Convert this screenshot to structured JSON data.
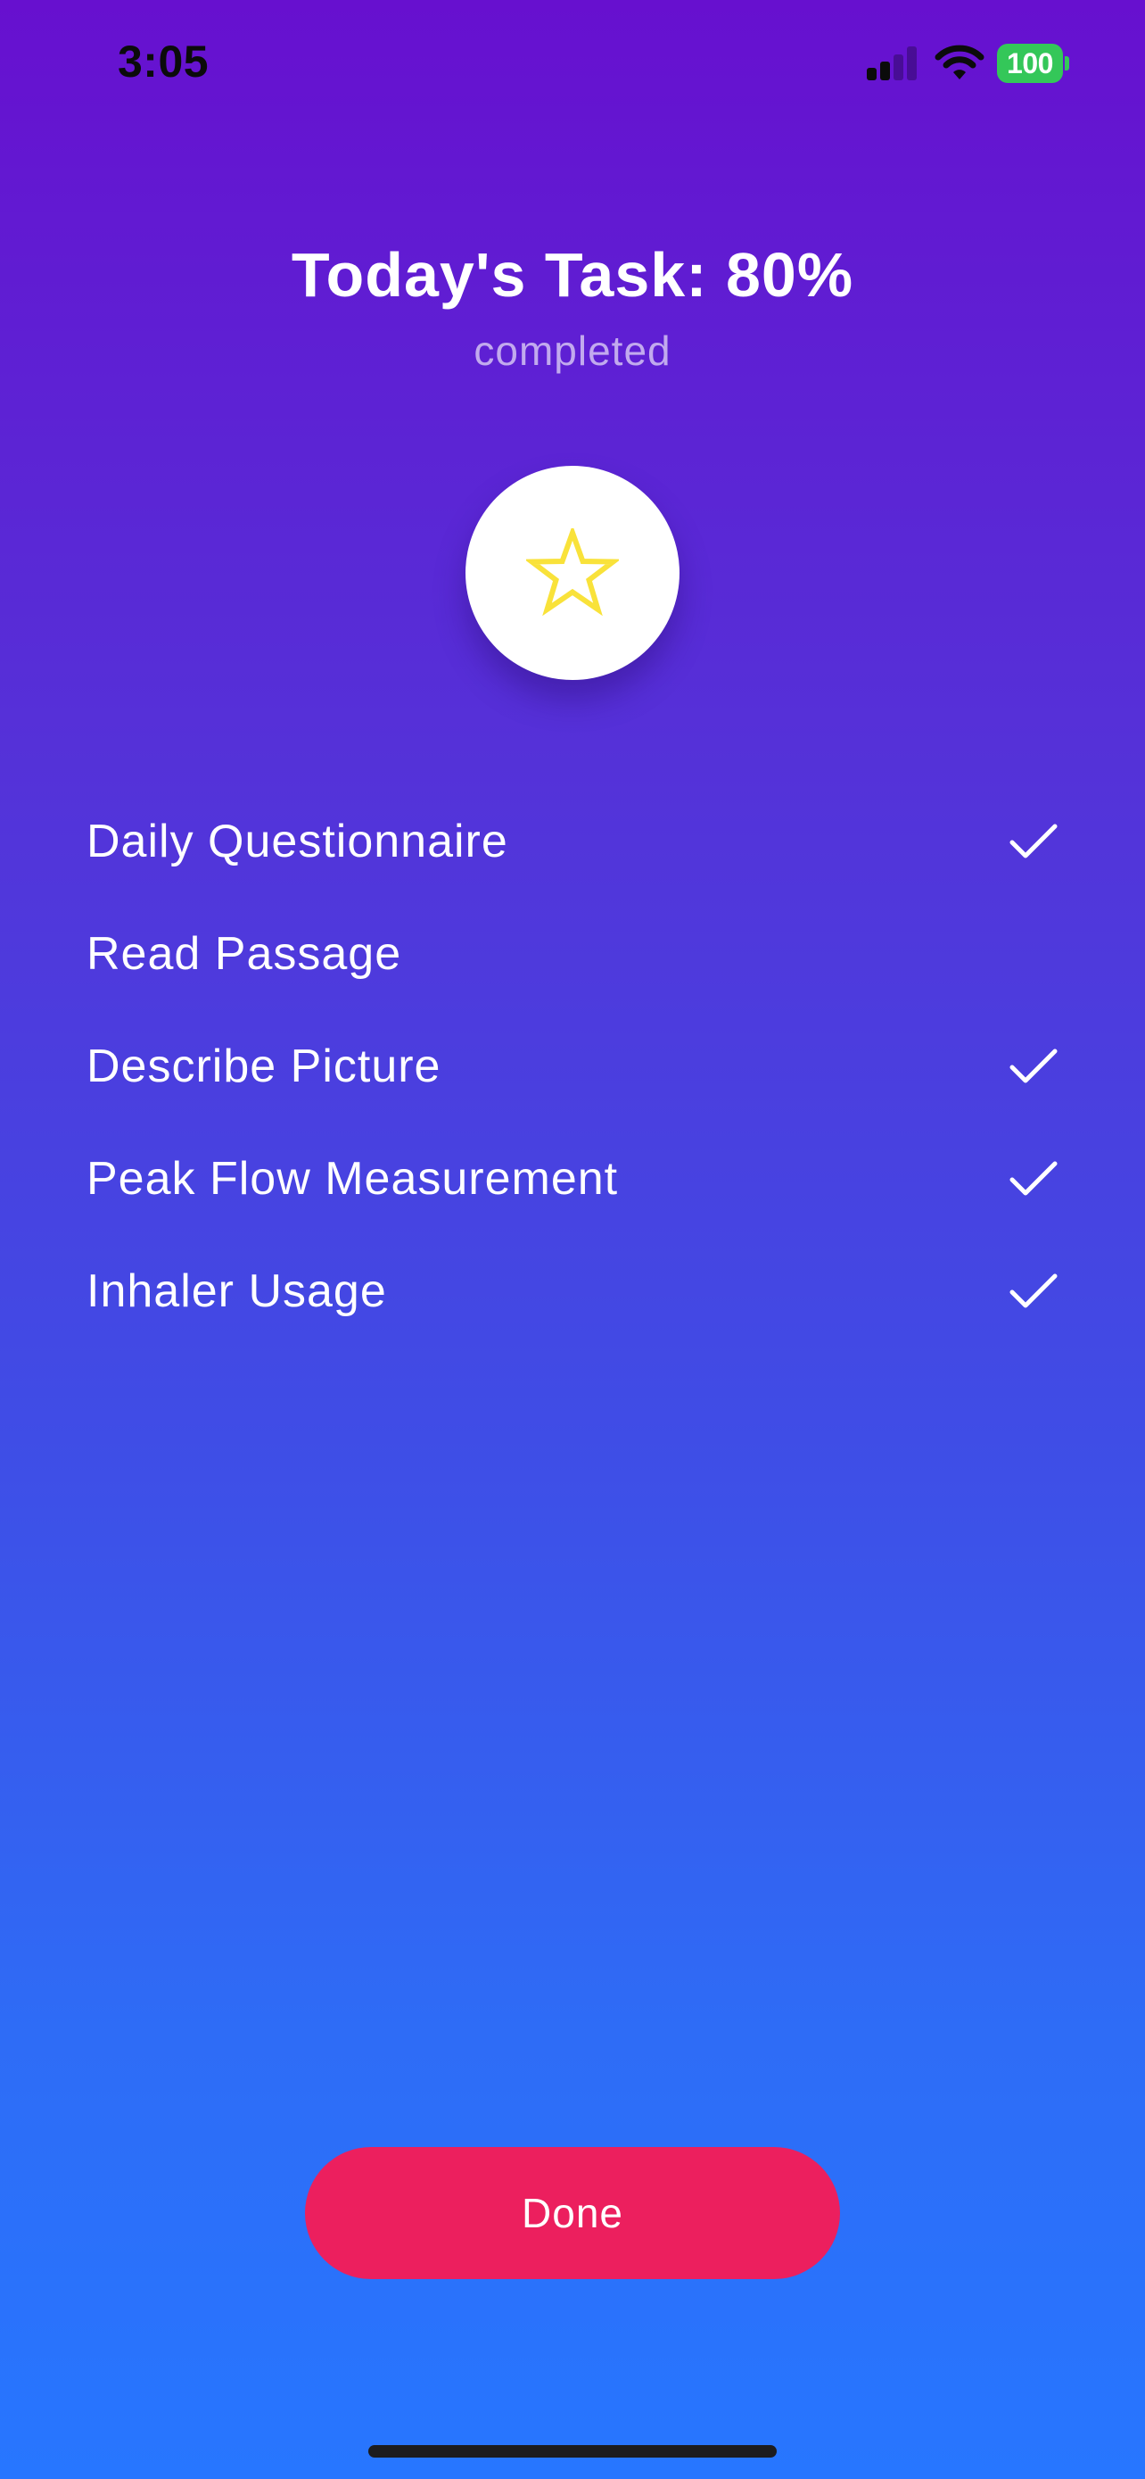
{
  "status_bar": {
    "time": "3:05",
    "battery": "100",
    "signal_bars_active": 2,
    "signal_bars_total": 4,
    "icons": [
      "signal-icon",
      "wifi-icon",
      "battery-icon"
    ]
  },
  "header": {
    "title": "Today's Task: 80%",
    "subtitle": "completed",
    "progress_percent": 80
  },
  "badge": {
    "icon": "star-icon",
    "star_color": "#F9E23A"
  },
  "tasks": [
    {
      "label": "Daily Questionnaire",
      "completed": true
    },
    {
      "label": "Read Passage",
      "completed": false
    },
    {
      "label": "Describe Picture",
      "completed": true
    },
    {
      "label": "Peak Flow Measurement",
      "completed": true
    },
    {
      "label": "Inhaler Usage",
      "completed": true
    }
  ],
  "done_button": {
    "label": "Done",
    "color": "#EC1F5E"
  },
  "colors": {
    "gradient_top": "#6710CF",
    "gradient_bottom": "#2776FF",
    "battery_green": "#34C759"
  }
}
